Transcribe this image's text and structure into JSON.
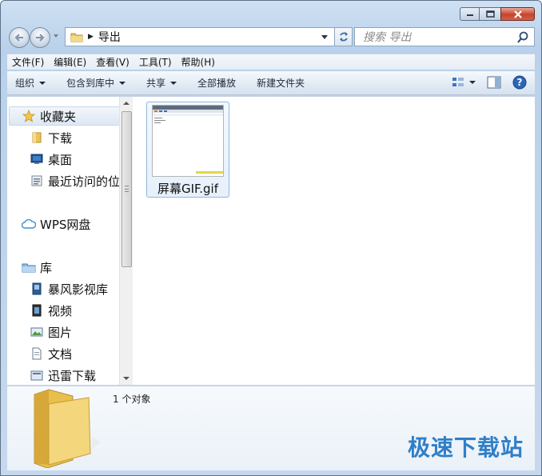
{
  "window": {
    "caption_buttons": [
      "minimize",
      "maximize",
      "close"
    ]
  },
  "address": {
    "path": "导出",
    "search_placeholder": "搜索 导出"
  },
  "menu": [
    "文件(F)",
    "编辑(E)",
    "查看(V)",
    "工具(T)",
    "帮助(H)"
  ],
  "toolbar": {
    "organize": "组织",
    "include_in_library": "包含到库中",
    "share": "共享",
    "play_all": "全部播放",
    "new_folder": "新建文件夹"
  },
  "sidebar": {
    "favorites": {
      "label": "收藏夹",
      "items": [
        "下载",
        "桌面",
        "最近访问的位"
      ]
    },
    "wps": "WPS网盘",
    "libraries": {
      "label": "库",
      "items": [
        "暴风影视库",
        "视频",
        "图片",
        "文档",
        "迅雷下载"
      ]
    }
  },
  "files": [
    {
      "name": "屏幕GIF.gif"
    }
  ],
  "status": {
    "count": "1 个对象"
  },
  "watermark": "极速下载站",
  "colors": {
    "accent": "#2f7fc7",
    "close_button": "#c7432c",
    "frame": "#b9d1ea"
  }
}
